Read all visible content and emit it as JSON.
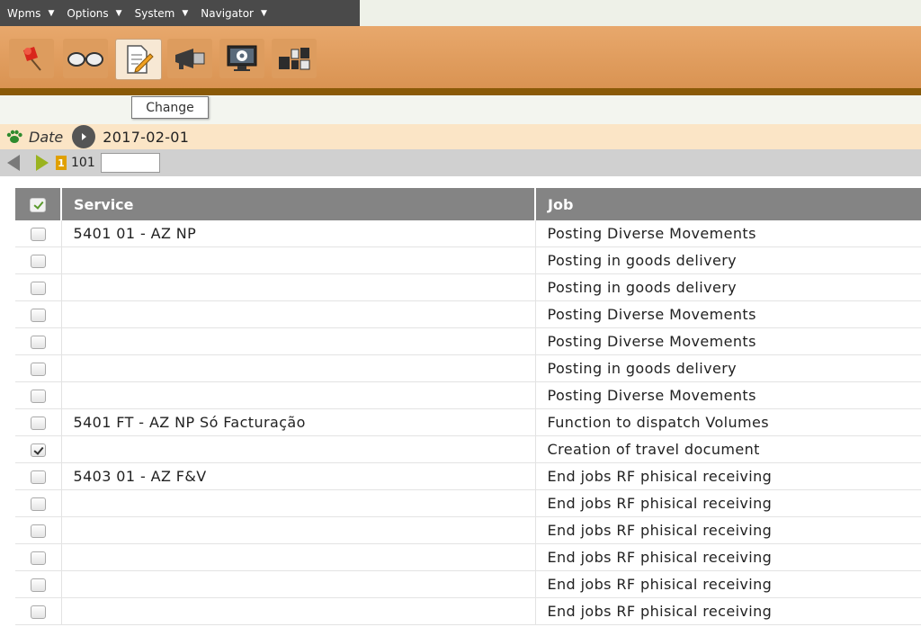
{
  "menu": [
    {
      "label": "Wpms"
    },
    {
      "label": "Options"
    },
    {
      "label": "System"
    },
    {
      "label": "Navigator"
    }
  ],
  "toolbar": {
    "buttons": [
      {
        "icon": "pin-icon"
      },
      {
        "icon": "glasses-icon"
      },
      {
        "icon": "edit-document-icon"
      },
      {
        "icon": "megaphone-icon"
      },
      {
        "icon": "monitor-settings-icon"
      },
      {
        "icon": "boxes-icon"
      }
    ],
    "active_index": 2,
    "tooltip": "Change"
  },
  "date_filter": {
    "label": "Date",
    "value": "2017-02-01"
  },
  "pager": {
    "current_page": "1",
    "total": "101",
    "input_value": ""
  },
  "table": {
    "columns": {
      "service": "Service",
      "job": "Job"
    },
    "rows": [
      {
        "checked": false,
        "service": "5401 01 - AZ NP",
        "job": "Posting Diverse Movements"
      },
      {
        "checked": false,
        "service": "",
        "job": "Posting in goods delivery"
      },
      {
        "checked": false,
        "service": "",
        "job": "Posting in goods delivery"
      },
      {
        "checked": false,
        "service": "",
        "job": "Posting Diverse Movements"
      },
      {
        "checked": false,
        "service": "",
        "job": "Posting Diverse Movements"
      },
      {
        "checked": false,
        "service": "",
        "job": "Posting in goods delivery"
      },
      {
        "checked": false,
        "service": "",
        "job": "Posting Diverse Movements"
      },
      {
        "checked": false,
        "service": "5401 FT - AZ NP Só Facturação",
        "job": "Function to dispatch Volumes"
      },
      {
        "checked": true,
        "service": "",
        "job": "Creation of travel document"
      },
      {
        "checked": false,
        "service": "5403 01 - AZ F&V",
        "job": "End jobs RF phisical receiving"
      },
      {
        "checked": false,
        "service": "",
        "job": "End jobs RF phisical receiving"
      },
      {
        "checked": false,
        "service": "",
        "job": "End jobs RF phisical receiving"
      },
      {
        "checked": false,
        "service": "",
        "job": "End jobs RF phisical receiving"
      },
      {
        "checked": false,
        "service": "",
        "job": "End jobs RF phisical receiving"
      },
      {
        "checked": false,
        "service": "",
        "job": "End jobs RF phisical receiving"
      }
    ]
  }
}
